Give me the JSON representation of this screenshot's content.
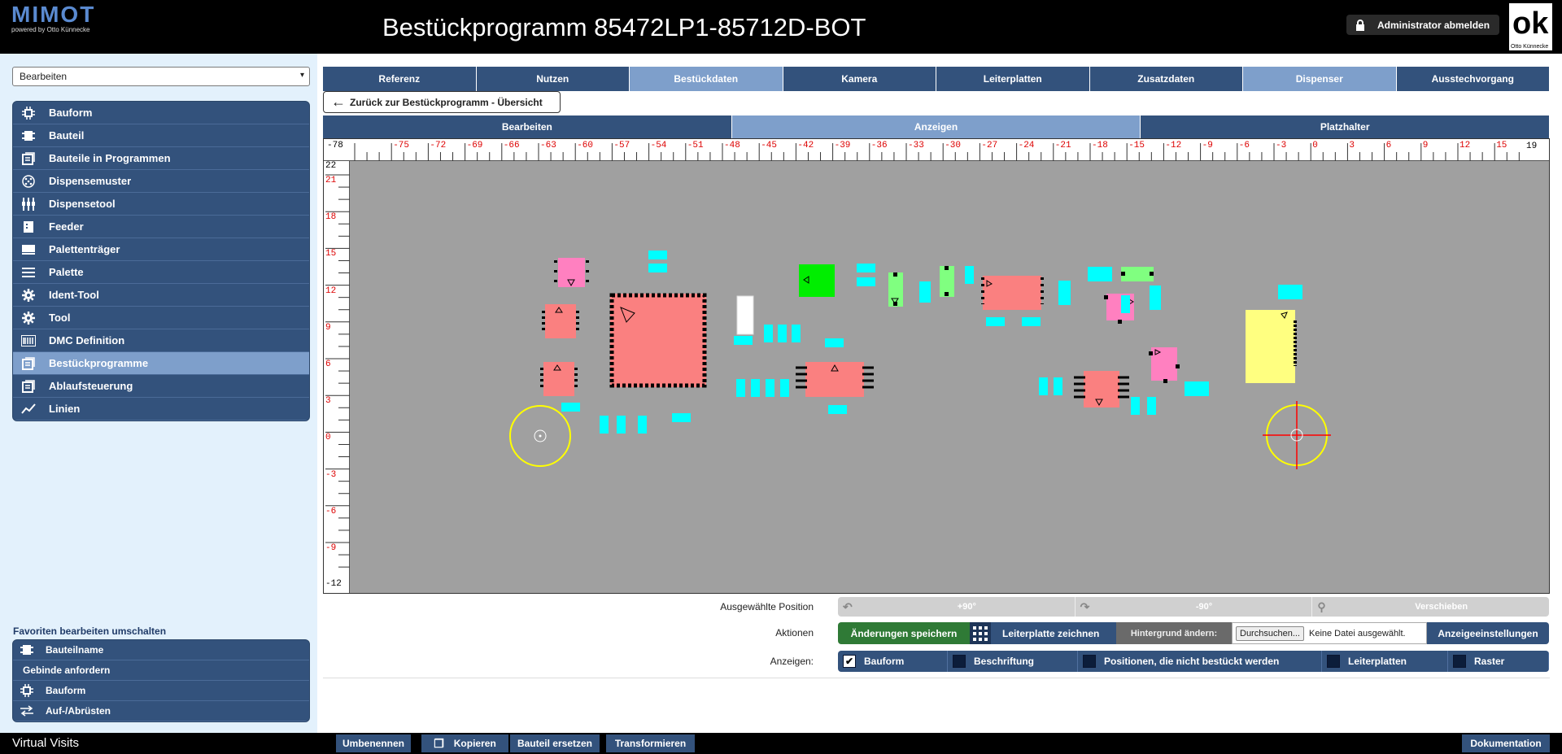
{
  "header": {
    "logo_text": "MIMOT",
    "logo_sub": "powered by Otto Künnecke",
    "title": "Bestückprogramm 85472LP1-85712D-BOT",
    "logout_label": "Administrator abmelden",
    "brand_logo_text": "ok",
    "brand_logo_sub": "Otto Künnecke"
  },
  "sidebar": {
    "mode_select_value": "Bearbeiten",
    "items": [
      {
        "label": "Bauform",
        "icon": "chip-icon"
      },
      {
        "label": "Bauteil",
        "icon": "component-icon"
      },
      {
        "label": "Bauteile in Programmen",
        "icon": "list-icon"
      },
      {
        "label": "Dispensemuster",
        "icon": "dot-pattern-icon"
      },
      {
        "label": "Dispensetool",
        "icon": "nozzle-icon"
      },
      {
        "label": "Feeder",
        "icon": "feeder-icon"
      },
      {
        "label": "Palettenträger",
        "icon": "pallet-carrier-icon"
      },
      {
        "label": "Palette",
        "icon": "lines-icon"
      },
      {
        "label": "Ident-Tool",
        "icon": "gear-icon"
      },
      {
        "label": "Tool",
        "icon": "gear-icon"
      },
      {
        "label": "DMC Definition",
        "icon": "barcode-icon"
      },
      {
        "label": "Bestückprogramme",
        "icon": "list-icon"
      },
      {
        "label": "Ablaufsteuerung",
        "icon": "list-icon"
      },
      {
        "label": "Linien",
        "icon": "chart-line-icon"
      }
    ],
    "active_index": 11,
    "favorites_title": "Favoriten bearbeiten umschalten",
    "favorites": [
      {
        "label": "Bauteilname",
        "icon": "component-icon"
      },
      {
        "label": "Gebinde anfordern",
        "icon": ""
      },
      {
        "label": "Bauform",
        "icon": "chip-icon"
      },
      {
        "label": "Auf-/Abrüsten",
        "icon": "swap-icon"
      }
    ]
  },
  "tabs": [
    "Referenz",
    "Nutzen",
    "Bestückdaten",
    "Kamera",
    "Leiterplatten",
    "Zusatzdaten",
    "Dispenser",
    "Ausstechvorgang"
  ],
  "tabs_selected": [
    2,
    6
  ],
  "back_label": "Zurück zur Bestückprogramm - Übersicht",
  "subtabs": [
    "Bearbeiten",
    "Anzeigen",
    "Platzhalter"
  ],
  "subtab_selected": 1,
  "ruler": {
    "top_start": "-78",
    "top_end": "19",
    "top_labels": [
      "-75",
      "-72",
      "-69",
      "-66",
      "-63",
      "-60",
      "-57",
      "-54",
      "-51",
      "-48",
      "-45",
      "-42",
      "-39",
      "-36",
      "-33",
      "-30",
      "-27",
      "-24",
      "-21",
      "-18",
      "-15",
      "-12",
      "-9",
      "-6",
      "-3",
      "0",
      "3",
      "6",
      "9",
      "12",
      "15"
    ],
    "left_start": "22",
    "left_end": "-12",
    "left_labels": [
      "21",
      "18",
      "15",
      "12",
      "9",
      "6",
      "3",
      "0",
      "-3",
      "-6",
      "-9"
    ]
  },
  "colors": {
    "nav": "#33527c",
    "nav_active": "#7e9fcb",
    "board": "#a0a0a0",
    "pad": "#00ffff",
    "component_red": "#fa8080",
    "component_pink": "#ff80c0",
    "component_green": "#80ff80",
    "component_yellow": "#ffff80",
    "save_green": "#2f7a36"
  },
  "controls": {
    "selected_position_label": "Ausgewählte Position",
    "rotate_plus": "+90°",
    "rotate_minus": "-90°",
    "move": "Verschieben",
    "actions_label": "Aktionen",
    "save": "Änderungen speichern",
    "draw_board": "Leiterplatte zeichnen",
    "change_bg": "Hintergrund ändern:",
    "browse": "Durchsuchen...",
    "no_file": "Keine Datei ausgewählt.",
    "display_settings": "Anzeigeeinstellungen",
    "show_label": "Anzeigen:",
    "show": [
      {
        "label": "Bauform",
        "checked": true
      },
      {
        "label": "Beschriftung",
        "checked": false
      },
      {
        "label": "Positionen, die nicht bestückt werden",
        "checked": false
      },
      {
        "label": "Leiterplatten",
        "checked": false
      },
      {
        "label": "Raster",
        "checked": false
      }
    ]
  },
  "footer": {
    "app_name": "Virtual Visits",
    "rename": "Umbenennen",
    "copy": "Kopieren",
    "replace": "Bauteil ersetzen",
    "transform": "Transformieren",
    "docs": "Dokumentation"
  }
}
